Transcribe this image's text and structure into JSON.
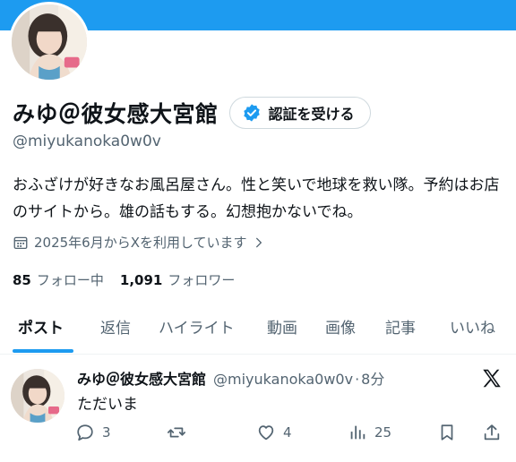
{
  "profile": {
    "display_name": "みゆ＠彼女感大宮館",
    "verify_label": "認証を受ける",
    "handle": "@miyukanoka0w0v",
    "bio": "おふざけが好きなお風呂屋さん。性と笑いで地球を救い隊。予約はお店のサイトから。雄の話もする。幻想抱かないでね。",
    "joined": "2025年6月からXを利用しています",
    "following_count": "85",
    "following_label": "フォロー中",
    "followers_count": "1,091",
    "followers_label": "フォロワー"
  },
  "tabs": [
    "ポスト",
    "返信",
    "ハイライト",
    "動画",
    "画像",
    "記事",
    "いいね"
  ],
  "active_tab": "ポスト",
  "tweet": {
    "name": "みゆ＠彼女感大宮館",
    "handle": "@miyukanoka0w0v",
    "separator": "·",
    "time": "8分",
    "text": "ただいま",
    "replies": "3",
    "likes": "4",
    "views": "25"
  },
  "icons": {
    "verify": "verified-badge-icon",
    "calendar": "calendar-icon",
    "chevron": "chevron-right-icon",
    "x_logo": "x-logo-icon",
    "reply": "reply-icon",
    "retweet": "retweet-icon",
    "like": "heart-icon",
    "views": "views-icon",
    "bookmark": "bookmark-icon",
    "share": "share-icon"
  },
  "colors": {
    "accent": "#1d9bf0",
    "text": "#0f1419",
    "muted": "#536471",
    "border": "#cfd9de"
  }
}
